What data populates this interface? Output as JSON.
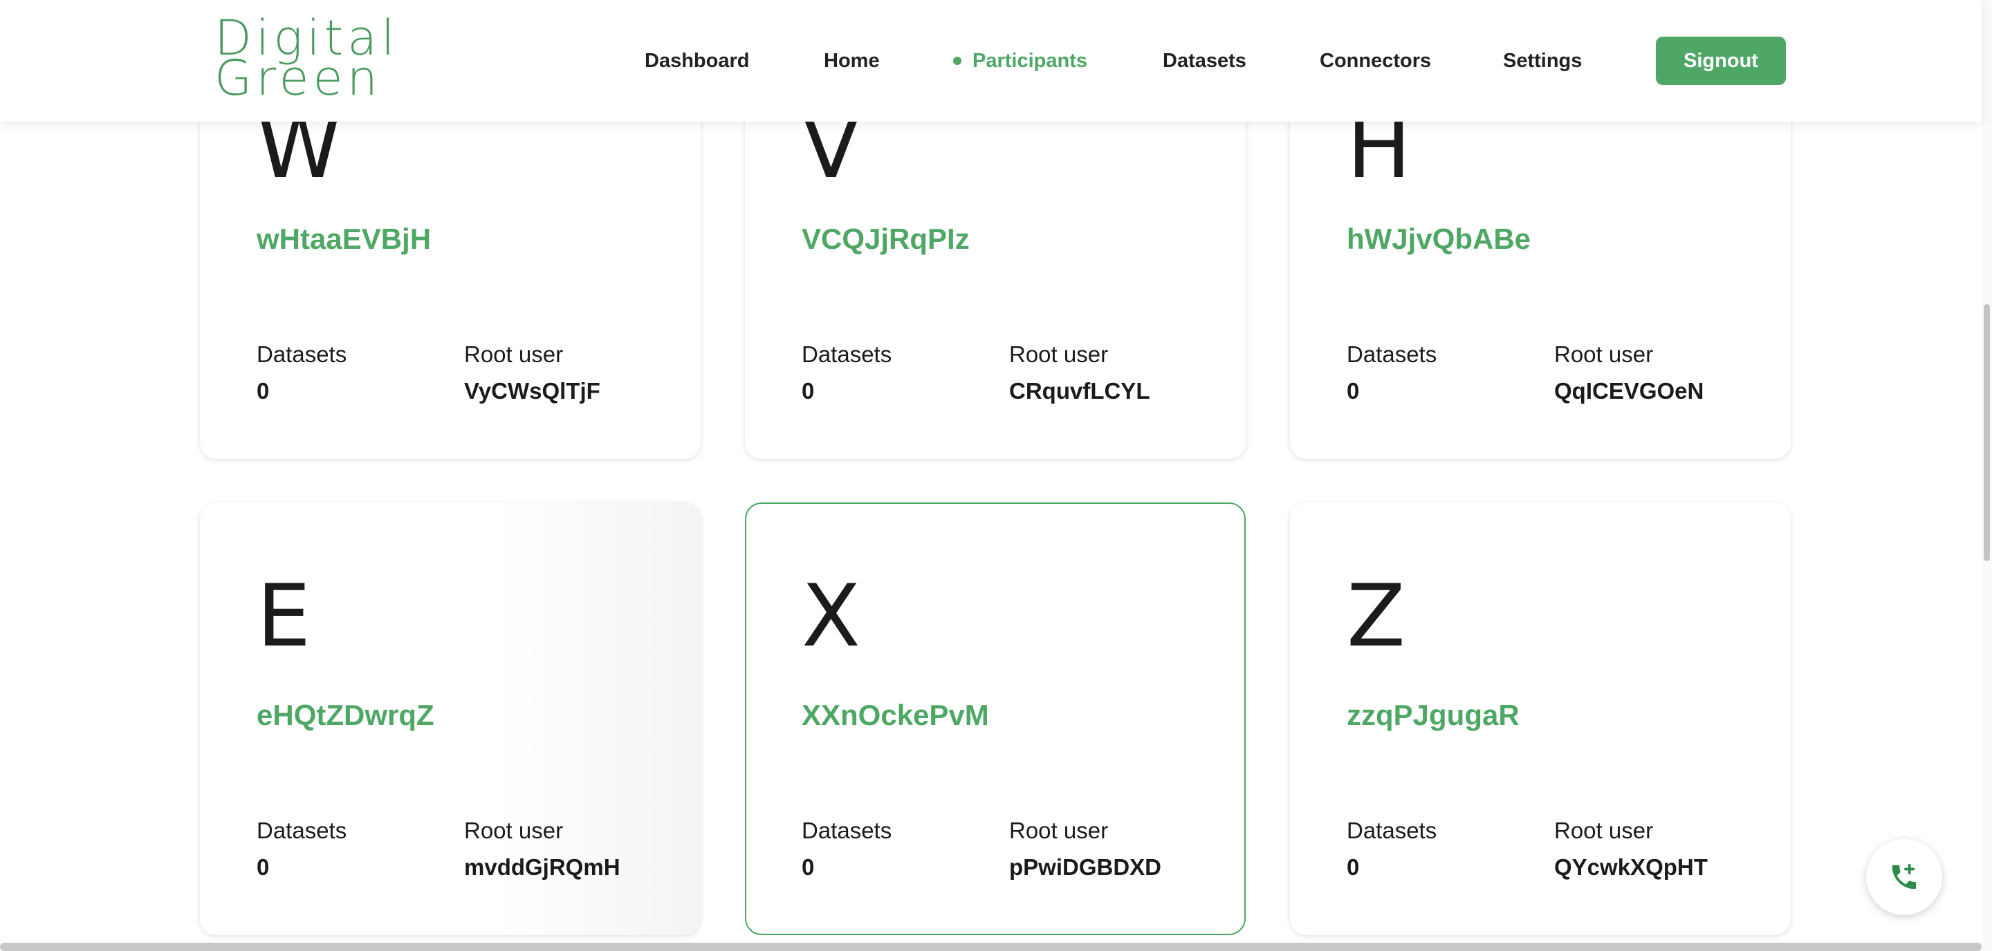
{
  "logo": {
    "line1": "Digital",
    "line2": "Green"
  },
  "nav": {
    "items": [
      {
        "label": "Dashboard"
      },
      {
        "label": "Home"
      },
      {
        "label": "Participants"
      },
      {
        "label": "Datasets"
      },
      {
        "label": "Connectors"
      },
      {
        "label": "Settings"
      }
    ],
    "active": "Participants",
    "signout_label": "Signout"
  },
  "participants": [
    {
      "initial": "W",
      "name": "wHtaaEVBjH",
      "datasets_label": "Datasets",
      "datasets": "0",
      "root_label": "Root user",
      "root_user": "VyCWsQlTjF"
    },
    {
      "initial": "V",
      "name": "VCQJjRqPIz",
      "datasets_label": "Datasets",
      "datasets": "0",
      "root_label": "Root user",
      "root_user": "CRquvfLCYL"
    },
    {
      "initial": "H",
      "name": "hWJjvQbABe",
      "datasets_label": "Datasets",
      "datasets": "0",
      "root_label": "Root user",
      "root_user": "QqICEVGOeN"
    },
    {
      "initial": "E",
      "name": "eHQtZDwrqZ",
      "datasets_label": "Datasets",
      "datasets": "0",
      "root_label": "Root user",
      "root_user": "mvddGjRQmH"
    },
    {
      "initial": "X",
      "name": "XXnOckePvM",
      "datasets_label": "Datasets",
      "datasets": "0",
      "root_label": "Root user",
      "root_user": "pPwiDGBDXD"
    },
    {
      "initial": "Z",
      "name": "zzqPJgugaR",
      "datasets_label": "Datasets",
      "datasets": "0",
      "root_label": "Root user",
      "root_user": "QYcwkXQpHT"
    }
  ],
  "colors": {
    "brand_green": "#4ea764",
    "text": "#1b1b1b"
  },
  "fab": {
    "icon": "phone-plus-icon"
  }
}
